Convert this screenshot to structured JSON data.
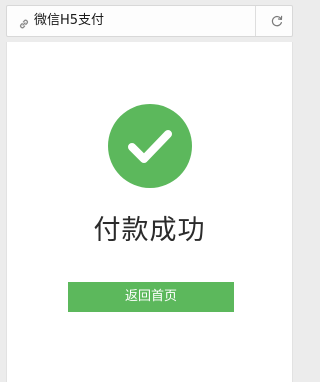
{
  "header": {
    "title": "微信H5支付",
    "leading_icon": "link-icon",
    "refresh_icon": "refresh-icon"
  },
  "result": {
    "icon": "check-circle-icon",
    "title": "付款成功",
    "color": "#5cb85c"
  },
  "actions": {
    "home_label": "返回首页"
  }
}
